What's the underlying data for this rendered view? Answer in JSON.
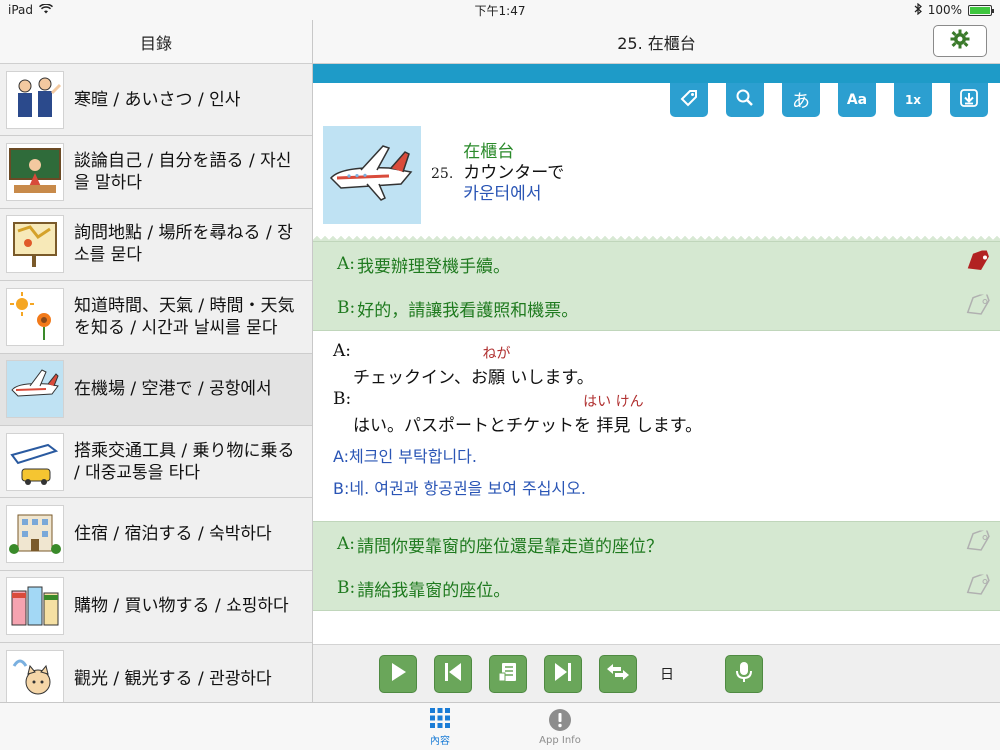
{
  "statusbar": {
    "device": "iPad",
    "time": "下午1:47",
    "battery_text": "100%",
    "battery_level": 1.0
  },
  "sidebar": {
    "title": "目錄",
    "items": [
      {
        "label": "寒暄 / あいさつ / 인사",
        "icon": "greeting-people-icon"
      },
      {
        "label": "談論自己 / 自分を語る / 자신을 말하다",
        "icon": "teacher-blackboard-icon"
      },
      {
        "label": "詢問地點 / 場所を尋ねる / 장소를 묻다",
        "icon": "map-board-icon"
      },
      {
        "label": "知道時間、天氣 / 時間・天気を知る / 시간과 날씨를 묻다",
        "icon": "sun-flower-icon"
      },
      {
        "label": "在機場 / 空港で / 공항에서",
        "icon": "airplane-icon"
      },
      {
        "label": "搭乘交通工具 / 乗り物に乗る / 대중교통을 타다",
        "icon": "train-taxi-icon"
      },
      {
        "label": "住宿 / 宿泊する / 숙박하다",
        "icon": "hotel-icon"
      },
      {
        "label": "購物 / 買い物する / 쇼핑하다",
        "icon": "shops-icon"
      },
      {
        "label": "觀光 / 観光する / 관광하다",
        "icon": "sightseeing-cat-icon"
      }
    ]
  },
  "main": {
    "title": "25. 在櫃台",
    "toolbar": {
      "items": [
        {
          "name": "tag-button",
          "icon": "tag-icon",
          "label": ""
        },
        {
          "name": "search-button",
          "icon": "search-icon",
          "label": ""
        },
        {
          "name": "kana-button",
          "icon": "kana-icon",
          "label": "あ"
        },
        {
          "name": "font-size-button",
          "icon": "font-size-icon",
          "label": "Aa"
        },
        {
          "name": "speed-button",
          "icon": "speed-icon",
          "label": "1x"
        },
        {
          "name": "download-button",
          "icon": "download-icon",
          "label": ""
        }
      ]
    },
    "lesson": {
      "number": "25.",
      "title_zh": "在櫃台",
      "title_ja": "カウンターで",
      "title_ko": "카운터에서"
    },
    "dialog1": {
      "zh_a": "我要辦理登機手續。",
      "zh_b": "好的，請讓我看護照和機票。",
      "speaker_a": "A:",
      "speaker_b": "B:",
      "ja_a_pre": "チェックイン、お",
      "ja_a_kanji": "願",
      "ja_a_ruby": "ねが",
      "ja_a_post": "いします。",
      "ja_b_pre": "はい。パスポートとチケットを",
      "ja_b_kanji": "拝見",
      "ja_b_ruby": "はい けん",
      "ja_b_post": "します。",
      "ko_a": "A:체크인 부탁합니다.",
      "ko_b": "B:네. 여권과 항공권을 보여 주십시오."
    },
    "dialog2": {
      "zh_a": "請問你要靠窗的座位還是靠走道的座位？",
      "zh_b": "請給我靠窗的座位。",
      "speaker_a": "A:",
      "speaker_b": "B:"
    },
    "controls": {
      "lang_label": "日"
    }
  },
  "tabbar": {
    "items": [
      {
        "label": "內容",
        "icon": "grid-icon",
        "active": true
      },
      {
        "label": "App Info",
        "icon": "info-icon",
        "active": false
      }
    ]
  },
  "colors": {
    "accent_blue": "#2c9fd0",
    "dialog_green": "#d5e8d1",
    "control_green": "#6aa65a",
    "tab_active": "#1a7cd6",
    "tag_active": "#b22222"
  }
}
